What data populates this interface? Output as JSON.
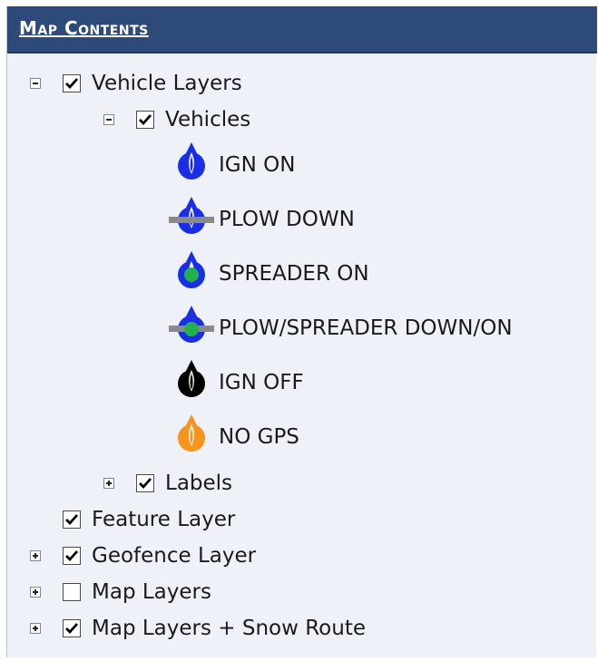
{
  "header": {
    "title": "Map Contents"
  },
  "tree": {
    "vehicle_layers": {
      "label": "Vehicle Layers",
      "checked": true,
      "expanded": true
    },
    "vehicles": {
      "label": "Vehicles",
      "checked": true,
      "expanded": true
    },
    "legend": [
      {
        "label": "IGN ON",
        "icon": "blue-vehicle-marker-icon",
        "color": "#1a2ee6"
      },
      {
        "label": "PLOW DOWN",
        "icon": "blue-vehicle-plow-marker-icon",
        "color": "#1a2ee6",
        "bar_color": "#8a8a8a"
      },
      {
        "label": "SPREADER ON",
        "icon": "blue-vehicle-spreader-marker-icon",
        "color": "#1a2ee6",
        "dot_color": "#22b14c"
      },
      {
        "label": "PLOW/SPREADER DOWN/ON",
        "icon": "blue-vehicle-plow-spreader-marker-icon",
        "color": "#1a2ee6",
        "bar_color": "#8a8a8a",
        "dot_color": "#22b14c"
      },
      {
        "label": "IGN OFF",
        "icon": "black-vehicle-marker-icon",
        "color": "#000000"
      },
      {
        "label": "NO GPS",
        "icon": "orange-vehicle-marker-icon",
        "color": "#f7941d"
      }
    ],
    "labels": {
      "label": "Labels",
      "checked": true,
      "expanded": false
    },
    "feature_layer": {
      "label": "Feature Layer",
      "checked": true
    },
    "geofence_layer": {
      "label": "Geofence Layer",
      "checked": true,
      "expanded": false
    },
    "map_layers": {
      "label": "Map Layers",
      "checked": false,
      "expanded": false
    },
    "map_layers_snow": {
      "label": "Map Layers + Snow Route",
      "checked": true,
      "expanded": false
    }
  }
}
